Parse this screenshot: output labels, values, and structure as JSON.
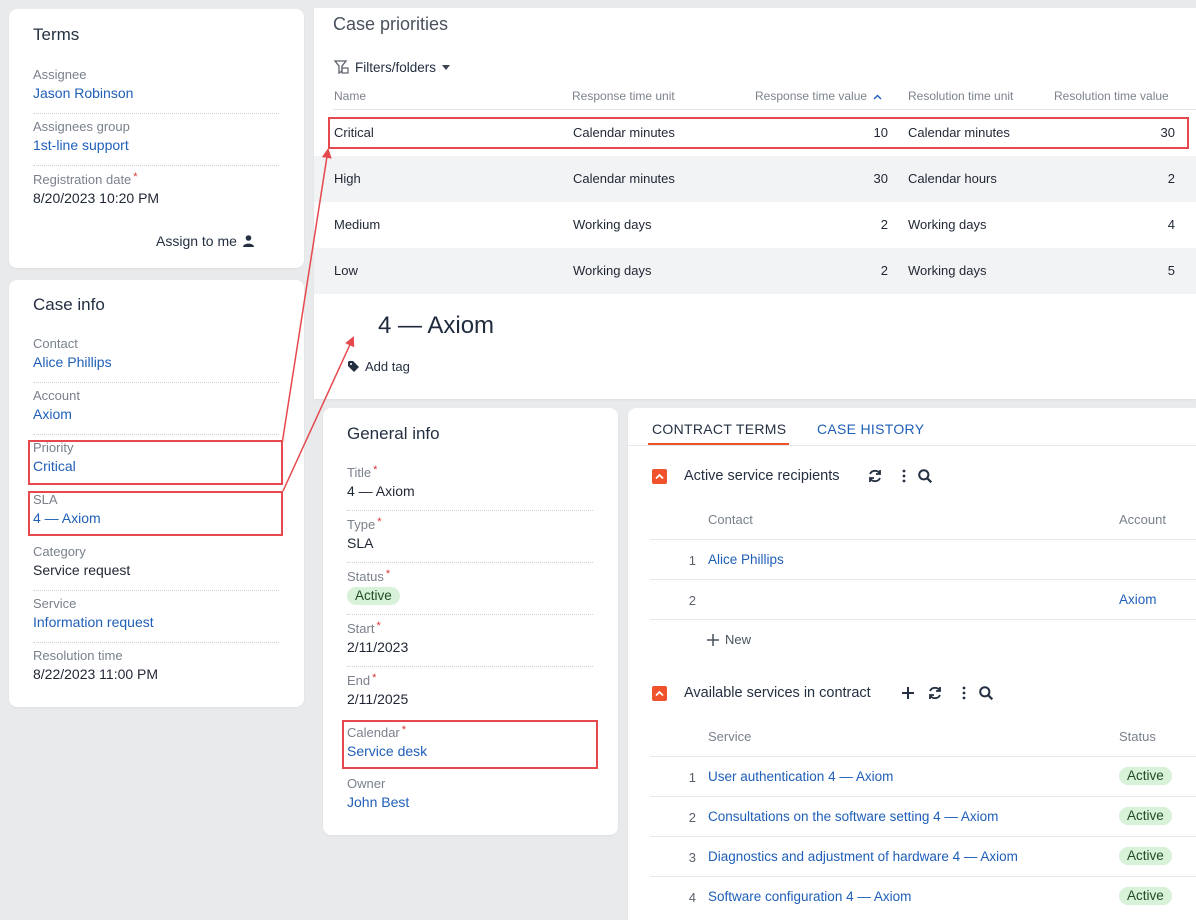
{
  "terms": {
    "title": "Terms",
    "assignee_label": "Assignee",
    "assignee_value": "Jason Robinson",
    "group_label": "Assignees group",
    "group_value": "1st-line support",
    "regdate_label": "Registration date",
    "regdate_value": "8/20/2023 10:20 PM",
    "assign_to_me": "Assign to me"
  },
  "case_info": {
    "title": "Case info",
    "contact_label": "Contact",
    "contact_value": "Alice Phillips",
    "account_label": "Account",
    "account_value": "Axiom",
    "priority_label": "Priority",
    "priority_value": "Critical",
    "sla_label": "SLA",
    "sla_value": "4 — Axiom",
    "category_label": "Category",
    "category_value": "Service request",
    "service_label": "Service",
    "service_value": "Information request",
    "resolution_label": "Resolution time",
    "resolution_value": "8/22/2023 11:00 PM"
  },
  "priorities": {
    "title": "Case priorities",
    "filters_label": "Filters/folders",
    "columns": [
      "Name",
      "Response time unit",
      "Response time value",
      "Resolution time unit",
      "Resolution time value"
    ],
    "rows": [
      [
        "Critical",
        "Calendar minutes",
        "10",
        "Calendar minutes",
        "30"
      ],
      [
        "High",
        "Calendar minutes",
        "30",
        "Calendar hours",
        "2"
      ],
      [
        "Medium",
        "Working days",
        "2",
        "Working days",
        "4"
      ],
      [
        "Low",
        "Working days",
        "2",
        "Working days",
        "5"
      ]
    ]
  },
  "record": {
    "title": "4 — Axiom",
    "add_tag": "Add tag"
  },
  "general_info": {
    "title": "General info",
    "title_label": "Title",
    "title_value": "4 — Axiom",
    "type_label": "Type",
    "type_value": "SLA",
    "status_label": "Status",
    "status_value": "Active",
    "start_label": "Start",
    "start_value": "2/11/2023",
    "end_label": "End",
    "end_value": "2/11/2025",
    "calendar_label": "Calendar",
    "calendar_value": "Service desk",
    "owner_label": "Owner",
    "owner_value": "John Best"
  },
  "tabs": {
    "contract_terms": "CONTRACT TERMS",
    "case_history": "CASE HISTORY"
  },
  "recipients": {
    "title": "Active service recipients",
    "col_contact": "Contact",
    "col_account": "Account",
    "rows": [
      {
        "num": "1",
        "contact": "Alice Phillips",
        "account": ""
      },
      {
        "num": "2",
        "contact": "",
        "account": "Axiom"
      }
    ],
    "new_label": "New"
  },
  "services": {
    "title": "Available services in contract",
    "col_service": "Service",
    "col_status": "Status",
    "rows": [
      {
        "num": "1",
        "service": "User authentication 4 — Axiom",
        "status": "Active"
      },
      {
        "num": "2",
        "service": "Consultations on the software setting 4 — Axiom",
        "status": "Active"
      },
      {
        "num": "3",
        "service": "Diagnostics and adjustment of hardware 4 — Axiom",
        "status": "Active"
      },
      {
        "num": "4",
        "service": "Software configuration 4 — Axiom",
        "status": "Active"
      }
    ]
  },
  "colors": {
    "link": "#1f5fb8",
    "annotation": "#e5484d",
    "badge_bg": "#d8f1d9",
    "collapse_icon": "#f0522b"
  }
}
